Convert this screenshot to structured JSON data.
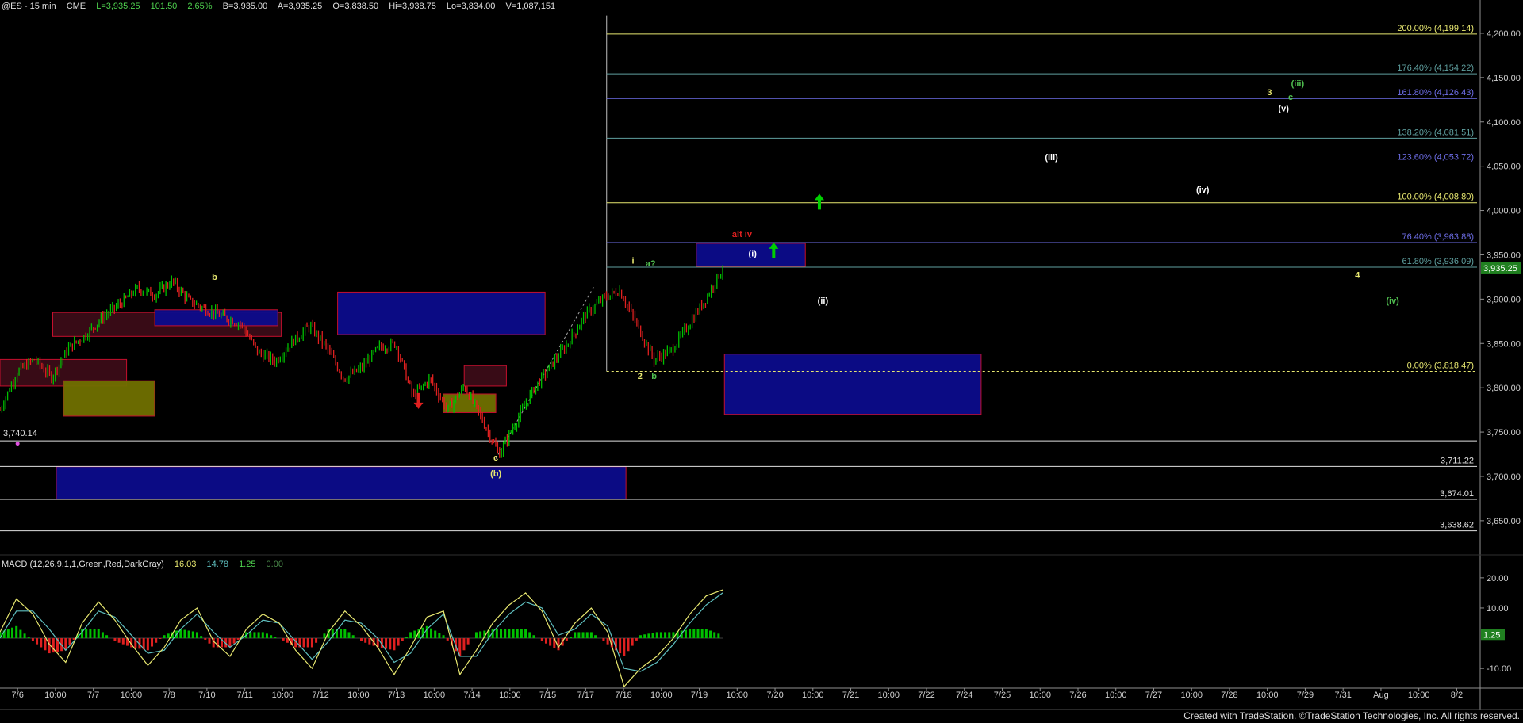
{
  "header": {
    "symbol": "@ES - 15 min",
    "exchange": "CME",
    "last": "L=3,935.25",
    "change": "101.50",
    "pct": "2.65%",
    "bid": "B=3,935.00",
    "ask": "A=3,935.25",
    "open": "O=3,838.50",
    "high": "Hi=3,938.75",
    "low": "Lo=3,834.00",
    "volume": "V=1,087,151"
  },
  "macd_header": {
    "label": "MACD (12,26,9,1,1,Green,Red,DarkGray)",
    "macd": "16.03",
    "signal": "14.78",
    "hist": "1.25",
    "zero": "0.00"
  },
  "credit": "Created with TradeStation. ©TradeStation Technologies, Inc. All rights reserved.",
  "colors": {
    "bg": "#000000",
    "up_candle": "#00c000",
    "down_candle": "#e02020",
    "axis": "#909090",
    "fib_yellow": "#e8e870",
    "fib_teal": "#5fa0a0",
    "fib_blue": "#6e6ee8",
    "fib_green": "#50c050",
    "box_blue_fill": "#0c0c8c",
    "box_border": "#d01030",
    "box_maroon_fill": "#3c0c18",
    "box_olive_fill": "#707000"
  },
  "chart_data": [
    {
      "type": "candlestick",
      "title": "@ES - 15 min",
      "ylim": [
        3615,
        4225
      ],
      "y_ticks": [
        "3,650.00",
        "3,700.00",
        "3,750.00",
        "3,800.00",
        "3,850.00",
        "3,900.00",
        "3,950.00",
        "4,000.00",
        "4,050.00",
        "4,100.00",
        "4,150.00",
        "4,200.00"
      ],
      "x_ticks": [
        "7/6",
        "10:00",
        "7/7",
        "10:00",
        "7/8",
        "7/10",
        "7/11",
        "10:00",
        "7/12",
        "10:00",
        "7/13",
        "10:00",
        "7/14",
        "10:00",
        "7/15",
        "7/17",
        "7/18",
        "10:00",
        "7/19",
        "10:00",
        "7/20",
        "10:00",
        "7/21",
        "10:00",
        "7/22",
        "7/24",
        "7/25",
        "10:00",
        "7/26",
        "10:00",
        "7/27",
        "10:00",
        "7/28",
        "10:00",
        "7/29",
        "7/31",
        "Aug",
        "10:00",
        "8/2"
      ],
      "price_path": [
        3775,
        3818,
        3832,
        3812,
        3845,
        3860,
        3880,
        3895,
        3912,
        3905,
        3920,
        3898,
        3888,
        3880,
        3872,
        3840,
        3830,
        3852,
        3870,
        3845,
        3810,
        3822,
        3845,
        3850,
        3790,
        3810,
        3775,
        3802,
        3765,
        3725,
        3762,
        3798,
        3825,
        3850,
        3882,
        3900,
        3910,
        3872,
        3832,
        3842,
        3870,
        3900,
        3935
      ],
      "last_label": "3,935.25",
      "series": [
        {
          "name": "200.00% (4,199.14)",
          "value": 4199.14
        },
        {
          "name": "176.40% (4,154.22)",
          "value": 4154.22
        },
        {
          "name": "161.80% (4,126.43)",
          "value": 4126.43
        },
        {
          "name": "138.20% (4,081.51)",
          "value": 4081.51
        },
        {
          "name": "123.60% (4,053.72)",
          "value": 4053.72
        },
        {
          "name": "100.00% (4,008.80)",
          "value": 4008.8
        },
        {
          "name": "76.40% (3,963.88)",
          "value": 3963.88
        },
        {
          "name": "61.80% (3,936.09)",
          "value": 3936.09
        },
        {
          "name": "0.00% (3,818.47)",
          "value": 3818.47
        }
      ],
      "support_levels": [
        {
          "label": "3,740.14",
          "value": 3740.14
        },
        {
          "label": "3,711.22",
          "value": 3711.22
        },
        {
          "label": "3,674.01",
          "value": 3674.01
        },
        {
          "label": "3,638.62",
          "value": 3638.62
        }
      ],
      "zones": [
        {
          "fill": "maroon",
          "from_bar": 0,
          "to_bar": 3.6,
          "low": 3802,
          "high": 3832
        },
        {
          "fill": "olive",
          "from_bar": 1.8,
          "to_bar": 4.4,
          "low": 3768,
          "high": 3808
        },
        {
          "fill": "maroon",
          "from_bar": 1.5,
          "to_bar": 8.0,
          "low": 3858,
          "high": 3885
        },
        {
          "fill": "blue",
          "from_bar": 4.4,
          "to_bar": 7.9,
          "low": 3870,
          "high": 3888
        },
        {
          "fill": "blue",
          "from_bar": 9.6,
          "to_bar": 15.5,
          "low": 3860,
          "high": 3908
        },
        {
          "fill": "maroon",
          "from_bar": 13.2,
          "to_bar": 14.4,
          "low": 3802,
          "high": 3825
        },
        {
          "fill": "olive",
          "from_bar": 12.6,
          "to_bar": 14.1,
          "low": 3772,
          "high": 3793
        },
        {
          "fill": "blue",
          "from_bar": 1.6,
          "to_bar": 17.8,
          "low": 3674,
          "high": 3711
        },
        {
          "fill": "blue",
          "from_bar": 19.8,
          "to_bar": 22.9,
          "low": 3937,
          "high": 3963
        },
        {
          "fill": "blue",
          "from_bar": 20.6,
          "to_bar": 27.9,
          "low": 3770,
          "high": 3838
        }
      ],
      "wave_labels": [
        {
          "text": "b",
          "color": "#e8e870",
          "bar": 6.1,
          "price": 3922
        },
        {
          "text": "c",
          "color": "#e8e870",
          "bar": 14.1,
          "price": 3718
        },
        {
          "text": "(b)",
          "color": "#e8e870",
          "bar": 14.1,
          "price": 3700
        },
        {
          "text": "i",
          "color": "#e8e870",
          "bar": 18.0,
          "price": 3940
        },
        {
          "text": "a?",
          "color": "#50c050",
          "bar": 18.5,
          "price": 3937
        },
        {
          "text": "2",
          "color": "#e8e870",
          "bar": 18.2,
          "price": 3810
        },
        {
          "text": "b",
          "color": "#50c050",
          "bar": 18.6,
          "price": 3810
        },
        {
          "text": "alt iv",
          "color": "#e02020",
          "bar": 21.1,
          "price": 3970
        },
        {
          "text": "(i)",
          "color": "#ffffff",
          "bar": 21.4,
          "price": 3948
        },
        {
          "text": "(ii)",
          "color": "#ffffff",
          "bar": 23.4,
          "price": 3895
        },
        {
          "text": "(iii)",
          "color": "#ffffff",
          "bar": 29.9,
          "price": 4057
        },
        {
          "text": "(iv)",
          "color": "#ffffff",
          "bar": 34.2,
          "price": 4020
        },
        {
          "text": "3",
          "color": "#e8e870",
          "bar": 36.1,
          "price": 4130
        },
        {
          "text": "(iii)",
          "color": "#50c050",
          "bar": 36.9,
          "price": 4140
        },
        {
          "text": "c",
          "color": "#50c050",
          "bar": 36.7,
          "price": 4125
        },
        {
          "text": "(v)",
          "color": "#ffffff",
          "bar": 36.5,
          "price": 4112
        },
        {
          "text": "4",
          "color": "#e8e870",
          "bar": 38.6,
          "price": 3924
        },
        {
          "text": "(iv)",
          "color": "#50c050",
          "bar": 39.6,
          "price": 3895
        }
      ],
      "arrows": [
        {
          "dir": "down",
          "color": "#e02020",
          "bar": 11.9,
          "price": 3785
        },
        {
          "dir": "up",
          "color": "#00d000",
          "bar": 22.0,
          "price": 3955
        },
        {
          "dir": "up",
          "color": "#00d000",
          "bar": 23.3,
          "price": 4010
        }
      ]
    },
    {
      "type": "line",
      "title": "MACD (12,26,9,1,1,Green,Red,DarkGray)",
      "ylim": [
        -16,
        26
      ],
      "y_ticks": [
        "20.00",
        "10.00",
        "-10.00"
      ],
      "last_label": "1.25",
      "series": [
        {
          "name": "MACD",
          "values": [
            2,
            13,
            8,
            -2,
            -8,
            5,
            12,
            6,
            -2,
            -9,
            -3,
            6,
            10,
            -1,
            -6,
            3,
            8,
            5,
            -4,
            -10,
            2,
            9,
            4,
            -3,
            -12,
            -3,
            7,
            9,
            -12,
            -4,
            5,
            11,
            15,
            9,
            -3,
            5,
            10,
            2,
            -16,
            -10,
            -6,
            0,
            8,
            14,
            16
          ]
        },
        {
          "name": "Signal",
          "values": [
            0,
            9,
            9,
            3,
            -4,
            2,
            9,
            7,
            1,
            -5,
            -4,
            3,
            8,
            2,
            -3,
            1,
            6,
            5,
            -1,
            -7,
            -1,
            6,
            5,
            0,
            -8,
            -5,
            3,
            8,
            -6,
            -6,
            2,
            8,
            12,
            10,
            1,
            3,
            8,
            4,
            -10,
            -11,
            -8,
            -2,
            5,
            11,
            15
          ]
        },
        {
          "name": "Histogram",
          "values": [
            2,
            4,
            -1,
            -5,
            -4,
            3,
            3,
            -1,
            -3,
            -4,
            1,
            3,
            2,
            -3,
            -3,
            2,
            2,
            0,
            -3,
            -3,
            3,
            3,
            -1,
            -3,
            -4,
            2,
            4,
            1,
            -6,
            2,
            3,
            3,
            3,
            -1,
            -4,
            2,
            2,
            -2,
            -6,
            1,
            2,
            2,
            3,
            3,
            1
          ]
        }
      ]
    }
  ]
}
